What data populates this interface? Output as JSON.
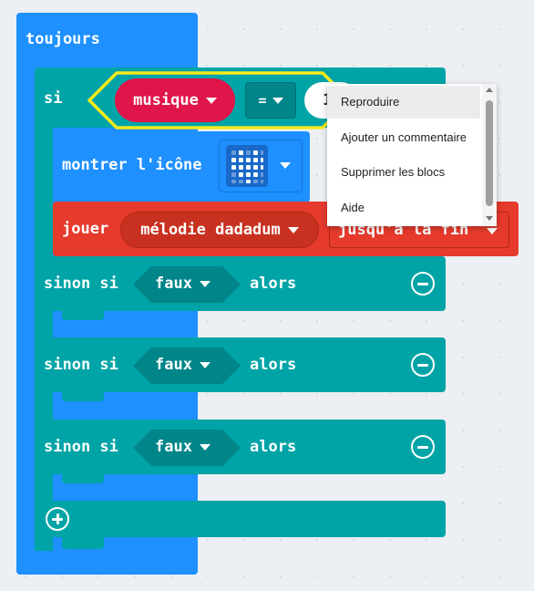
{
  "outer": {
    "label": "toujours"
  },
  "if_block": {
    "keyword": "si",
    "condition": {
      "variable": "musique",
      "operator": "=",
      "value": "1"
    }
  },
  "show_icon": {
    "label": "montrer l'icône"
  },
  "play": {
    "keyword": "jouer",
    "melody": "mélodie dadadum",
    "mode": "jusqu'à la fin"
  },
  "else_ifs": [
    {
      "keyword": "sinon si",
      "condition": "faux",
      "then": "alors"
    },
    {
      "keyword": "sinon si",
      "condition": "faux",
      "then": "alors"
    },
    {
      "keyword": "sinon si",
      "condition": "faux",
      "then": "alors"
    }
  ],
  "context_menu": {
    "items": [
      "Reproduire",
      "Ajouter un commentaire",
      "Supprimer les blocs",
      "Aide"
    ]
  }
}
